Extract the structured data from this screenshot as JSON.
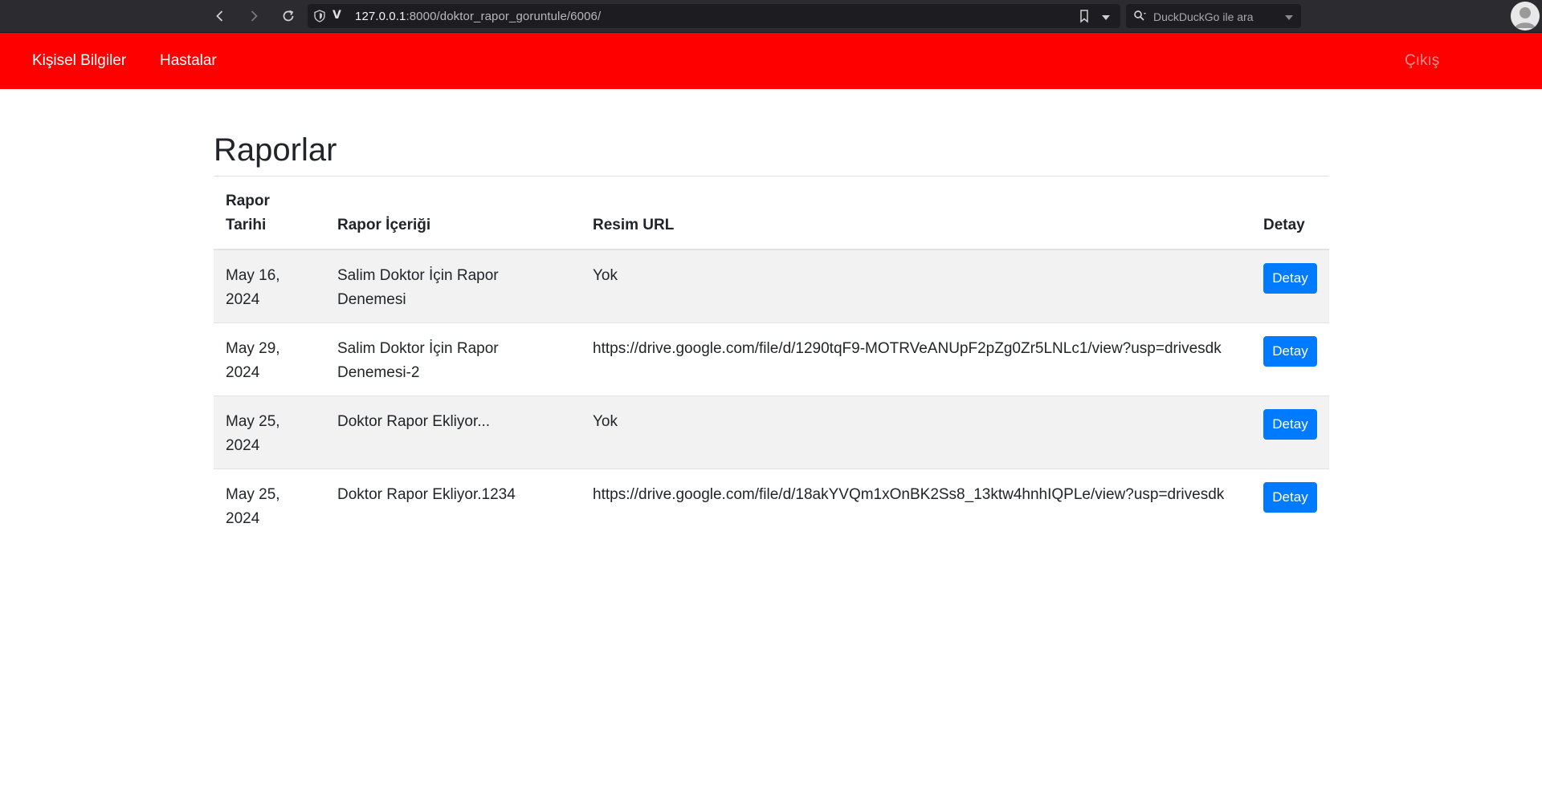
{
  "browser": {
    "url_host": "127.0.0.1",
    "url_rest": ":8000/doktor_rapor_goruntule/6006/",
    "search_placeholder": "DuckDuckGo ile ara"
  },
  "navbar": {
    "brand_color": "#ff0000",
    "personal_info": "Kişisel Bilgiler",
    "patients": "Hastalar",
    "logout": "Çıkış"
  },
  "page": {
    "title": "Raporlar"
  },
  "table": {
    "headers": {
      "date": "Rapor Tarihi",
      "content": "Rapor İçeriği",
      "image_url": "Resim URL",
      "detail": "Detay"
    },
    "rows": [
      {
        "date": "May 16, 2024",
        "content": "Salim Doktor İçin Rapor Denemesi",
        "image_url": "Yok",
        "detail_label": "Detay"
      },
      {
        "date": "May 29, 2024",
        "content": "Salim Doktor İçin Rapor Denemesi-2",
        "image_url": "https://drive.google.com/file/d/1290tqF9-MOTRVeANUpF2pZg0Zr5LNLc1/view?usp=drivesdk",
        "detail_label": "Detay"
      },
      {
        "date": "May 25, 2024",
        "content": "Doktor Rapor Ekliyor...",
        "image_url": "Yok",
        "detail_label": "Detay"
      },
      {
        "date": "May 25, 2024",
        "content": "Doktor Rapor Ekliyor.1234",
        "image_url": "https://drive.google.com/file/d/18akYVQm1xOnBK2Ss8_13ktw4hnhIQPLe/view?usp=drivesdk",
        "detail_label": "Detay"
      }
    ]
  },
  "colors": {
    "button": "#007bff",
    "stripe": "#f2f2f2"
  }
}
